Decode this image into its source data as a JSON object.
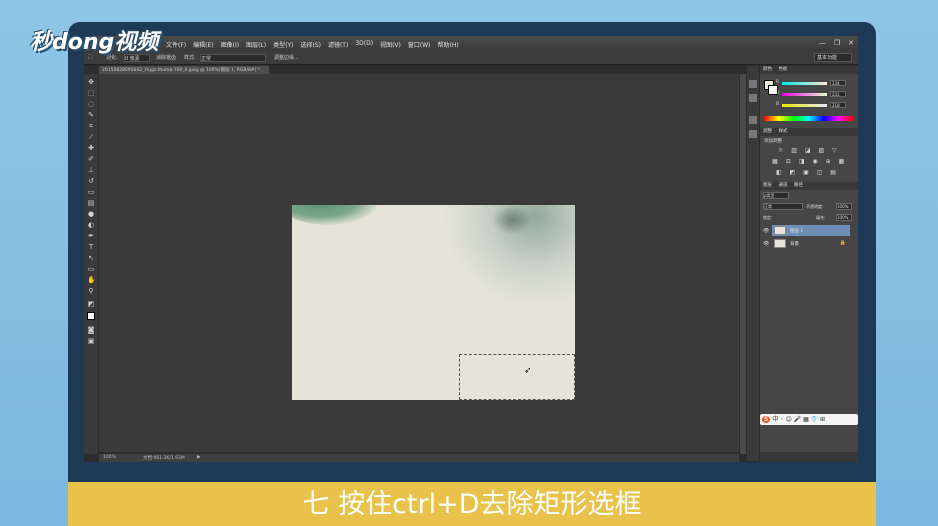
{
  "logo": {
    "text": "秒dong视频"
  },
  "window": {
    "menu": [
      "文件(F)",
      "编辑(E)",
      "图像(I)",
      "图层(L)",
      "类型(Y)",
      "选择(S)",
      "滤镜(T)",
      "3D(D)",
      "视图(V)",
      "窗口(W)",
      "帮助(H)"
    ],
    "controls": {
      "minimize": "—",
      "restore": "❐",
      "close": "✕"
    }
  },
  "options_bar": {
    "feather_label": "羽化:",
    "feather_value": "0 像素",
    "antialias": "消除锯齿",
    "style_label": "样式:",
    "style_value": "正常",
    "refine_edge": "调整边缘...",
    "preset": "基本功能"
  },
  "document": {
    "tab_title": "20150828095642_Ykjgz.thumb.700_0.jpeg @ 100%(图层 1, RGB/8#) *",
    "zoom": "100%",
    "doc_info": "文档:961.2K/1.93M"
  },
  "panels": {
    "color": {
      "tabs": [
        "颜色",
        "色板"
      ],
      "r_label": "R",
      "g_label": "G",
      "b_label": "B",
      "r": "234",
      "g": "231",
      "b": "218"
    },
    "adjustments": {
      "tabs": [
        "调整",
        "样式"
      ],
      "title": "添加调整",
      "row1": "☼ ▥ ◪ ▨ ▽",
      "row2": "▦ ⚖ ◨ ◉ ⊕ ▦",
      "row3": "◧ ◩ ▣ ◫ ▤"
    },
    "layers": {
      "tabs": [
        "图层",
        "通道",
        "路径"
      ],
      "kind": "ρ类型",
      "blend": "正常",
      "opacity_label": "不透明度:",
      "opacity": "100%",
      "lock_label": "锁定:",
      "fill_label": "填充:",
      "fill": "100%",
      "items": [
        {
          "name": "图层 1",
          "selected": true
        },
        {
          "name": "背景",
          "selected": false
        }
      ]
    }
  },
  "ime": {
    "label": "中 ◦ ☺ 🎤 ▦ 👕 ⊞"
  },
  "caption": {
    "text": "七 按住ctrl+D去除矩形选框"
  }
}
